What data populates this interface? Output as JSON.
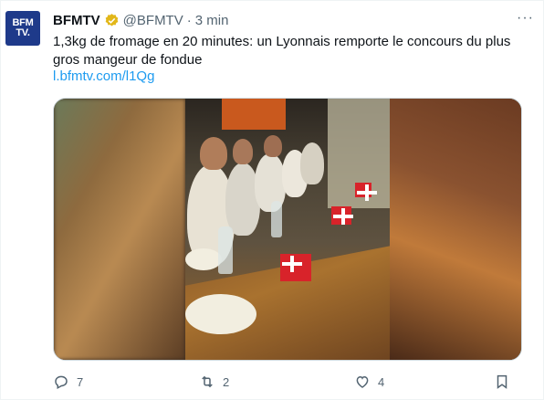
{
  "account": {
    "avatar_text_line1": "BFM",
    "avatar_text_line2": "TV.",
    "name": "BFMTV",
    "handle": "@BFMTV",
    "separator": "·",
    "time": "3 min",
    "verified_color": "#e2b719"
  },
  "more_label": "···",
  "tweet": {
    "text": "1,3kg de fromage en 20 minutes: un Lyonnais remporte le concours du plus gros mangeur de fondue",
    "link": "l.bfmtv.com/l1Qg"
  },
  "media": {
    "type": "video thumbnail"
  },
  "actions": {
    "replies": "7",
    "retweets": "2",
    "likes": "4"
  },
  "colors": {
    "accent": "#1d9bf0",
    "secondary_text": "#536471"
  }
}
